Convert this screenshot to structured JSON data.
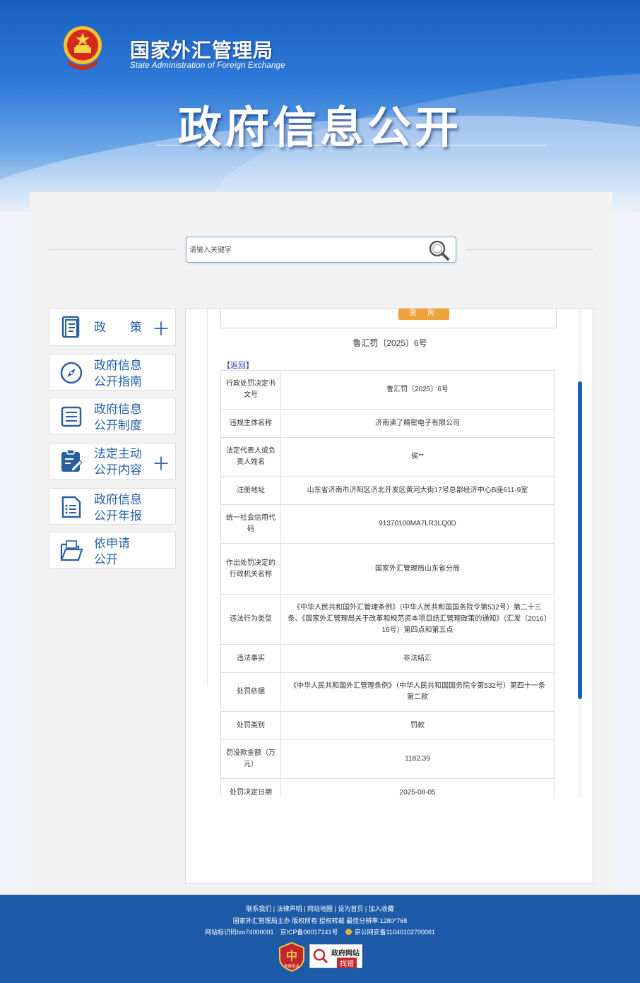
{
  "header": {
    "agency_cn": "国家外汇管理局",
    "agency_en": "State Administration of Foreign Exchange",
    "page_title": "政府信息公开"
  },
  "search": {
    "placeholder": "请输入关键字"
  },
  "sidebar": {
    "items": [
      {
        "label": "政　　策",
        "has_plus": true,
        "icon": "book-icon"
      },
      {
        "label": "政府信息\n公开指南",
        "has_plus": false,
        "icon": "compass-icon"
      },
      {
        "label": "政府信息\n公开制度",
        "has_plus": false,
        "icon": "list-icon"
      },
      {
        "label": "法定主动\n公开内容",
        "has_plus": true,
        "icon": "clipboard-edit-icon"
      },
      {
        "label": "政府信息\n公开年报",
        "has_plus": false,
        "icon": "report-icon"
      },
      {
        "label": "依申请\n公开",
        "has_plus": false,
        "icon": "folder-open-icon"
      }
    ]
  },
  "content": {
    "query_button": "查 询",
    "doc_number": "鲁汇罚〔2025〕6号",
    "back_link": "【返回】",
    "rows": [
      {
        "k": "行政处罚决定书文号",
        "v": "鲁汇罚〔2025〕6号"
      },
      {
        "k": "违规主体名称",
        "v": "济南沸了精密电子有限公司"
      },
      {
        "k": "法定代表人或负责人姓名",
        "v": "侯**"
      },
      {
        "k": "注册地址",
        "v": "山东省济南市济阳区济北开发区黄河大街17号总部经济中心B座611-9室"
      },
      {
        "k": "统一社会信用代码",
        "v": "91370100MA7LR3LQ0D"
      },
      {
        "k": "作出处罚决定的行政机关名称",
        "v": "国家外汇管理局山东省分局"
      },
      {
        "k": "违法行为类型",
        "v": "《中华人民共和国外汇管理条例》（中华人民共和国国务院令第532号）第二十三条、《国家外汇管理局关于改革和规范资本项目结汇管理政策的通知》（汇发〔2016〕16号）第四点和第五点"
      },
      {
        "k": "违法事实",
        "v": "非法结汇"
      },
      {
        "k": "处罚依据",
        "v": "《中华人民共和国外汇管理条例》（中华人民共和国国务院令第532号）第四十一条第二款"
      },
      {
        "k": "处罚类别",
        "v": "罚款"
      },
      {
        "k": "罚没款金额（万元）",
        "v": "1182.39"
      },
      {
        "k": "处罚决定日期",
        "v": "2025-08-05"
      }
    ]
  },
  "footer": {
    "links": [
      "联系我们",
      "法律声明",
      "网站地图",
      "设为首页",
      "加入收藏"
    ],
    "line2": "国家外汇管理局主办 版权所有 授权转载 最佳分辨率:1280*768",
    "line3_a": "网站标识码bm74000001　京ICP备06017241号",
    "line3_b": "京公网安备11040102700061",
    "badge1": "党政机关",
    "badge2_top": "政府网站",
    "badge2_bottom": "找错"
  },
  "colors": {
    "accent_blue": "#1d5aa8",
    "link_blue": "#2160a8",
    "query_orange": "#f0a23a"
  }
}
